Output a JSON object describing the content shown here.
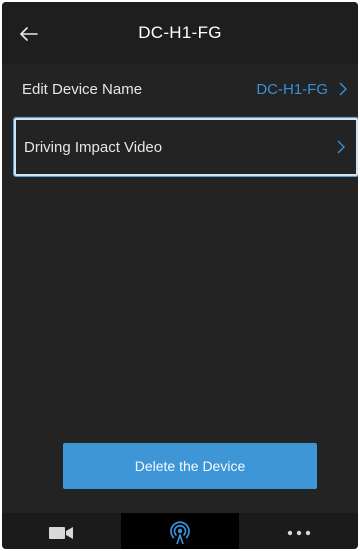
{
  "header": {
    "title": "DC-H1-FG",
    "back_icon": "arrow-left-icon"
  },
  "settings": {
    "edit_device_name": {
      "label": "Edit Device Name",
      "value": "DC-H1-FG",
      "icon": "chevron-right-icon"
    },
    "driving_impact_video": {
      "label": "Driving Impact Video",
      "icon": "chevron-right-icon"
    }
  },
  "actions": {
    "delete_label": "Delete the Device"
  },
  "tabbar": {
    "tabs": [
      {
        "icon": "video-camera-icon",
        "active": false
      },
      {
        "icon": "signal-broadcast-icon",
        "active": true
      },
      {
        "icon": "more-dots-icon",
        "active": false
      }
    ]
  },
  "colors": {
    "background": "#232323",
    "header": "#1e1e1e",
    "accent": "#3e96d6",
    "value_text": "#3a8fd9",
    "focus_border": "#cfe4f5"
  }
}
